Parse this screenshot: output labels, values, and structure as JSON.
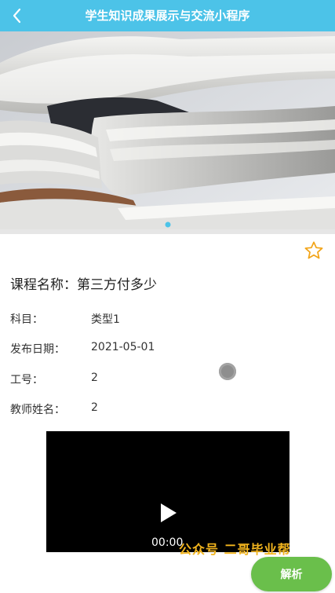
{
  "header": {
    "title": "学生知识成果展示与交流小程序",
    "back_icon": "chevron-left-icon",
    "bg_color": "#4cc3e8"
  },
  "banner": {
    "image": "photo of stacked open books",
    "active_indicator_color": "#4cc3e8"
  },
  "favorite": {
    "icon": "star-outline-icon",
    "color": "#f2a418"
  },
  "course": {
    "title_label": "课程名称：",
    "title_value": "第三方付多少"
  },
  "fields": [
    {
      "label": "科目：",
      "value": "类型1"
    },
    {
      "label": "发布日期：",
      "value": "2021-05-01"
    },
    {
      "label": "工号：",
      "value": "2"
    },
    {
      "label": "教师姓名：",
      "value": "2"
    }
  ],
  "video": {
    "time": "00:00",
    "play_icon": "play-icon"
  },
  "watermark": "公众号 二哥毕业帮",
  "analysis_button": {
    "label": "解析",
    "color": "#6abf4b"
  }
}
